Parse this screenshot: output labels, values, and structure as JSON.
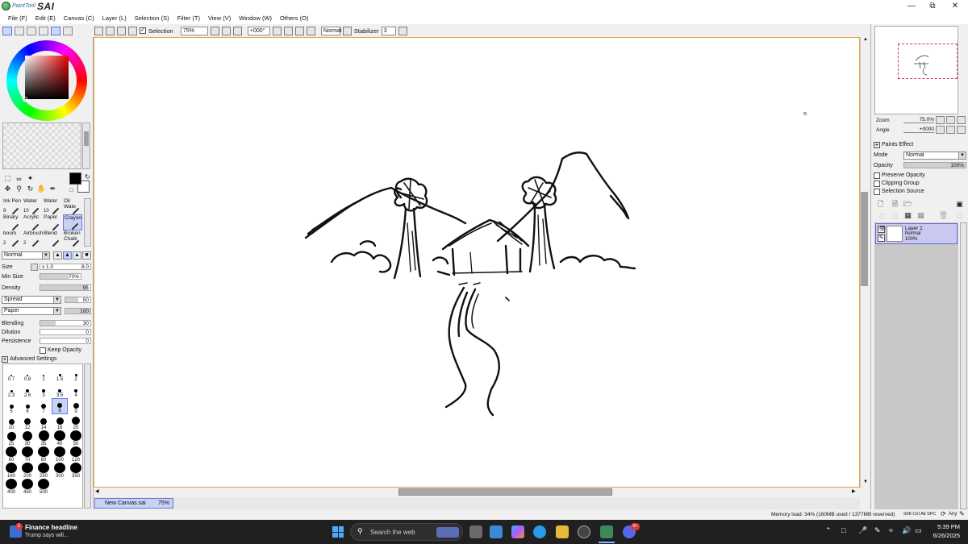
{
  "app": {
    "logo_small": "PaintTool",
    "logo_big": "SAI",
    "window_controls": [
      "minimize-icon",
      "restore-icon",
      "close-icon"
    ]
  },
  "menu": [
    "File (F)",
    "Edit (E)",
    "Canvas (C)",
    "Layer (L)",
    "Selection (S)",
    "Filter (T)",
    "View (V)",
    "Window (W)",
    "Others (O)"
  ],
  "toolbar": {
    "selection_label": "Selection",
    "zoom_value": "75%",
    "angle_value": "+000°",
    "mode_value": "Normal",
    "stabilizer_label": "Stabilizer",
    "stabilizer_value": "3"
  },
  "brushes": [
    {
      "name": "Ink Pen",
      "size": "9"
    },
    {
      "name": "Water",
      "size": "10"
    },
    {
      "name": "Water",
      "size": "10"
    },
    {
      "name": "Oil Wate",
      "size": ""
    },
    {
      "name": "Binary",
      "size": ""
    },
    {
      "name": "Acrylic",
      "size": ""
    },
    {
      "name": "Paper",
      "size": ""
    },
    {
      "name": "Crayon",
      "size": ""
    },
    {
      "name": "boom",
      "size": "2"
    },
    {
      "name": "Airbrush",
      "size": "2"
    },
    {
      "name": "Blend",
      "size": ""
    },
    {
      "name": "Broken Chalk",
      "size": ""
    }
  ],
  "selected_brush": "Crayon",
  "brush_props": {
    "blend_mode": "Normal",
    "size_label": "Size",
    "size_mult": "x 1.0",
    "size_value": "8.0",
    "min_size_label": "Min Size",
    "min_size_value": "70%",
    "min_size_fraction": 0.7,
    "density_label": "Density",
    "density_value": "95",
    "density_fraction": 0.95,
    "spread_label": "Spread",
    "spread_value": "50",
    "paper_label": "Paper",
    "paper_value": "100",
    "blending_label": "Blending",
    "blending_value": "30",
    "blending_fraction": 0.3,
    "dilution_label": "Dilution",
    "dilution_value": "0",
    "persistence_label": "Persistence",
    "persistence_value": "0",
    "keep_opacity_label": "Keep Opacity",
    "advanced_label": "Advanced Settings"
  },
  "brush_sizes": [
    "0.7",
    "0.8",
    "1",
    "1.5",
    "2",
    "2.3",
    "2.6",
    "3",
    "3.5",
    "4",
    "5",
    "6",
    "7",
    "8",
    "9",
    "10",
    "12",
    "14",
    "16",
    "20",
    "25",
    "30",
    "35",
    "40",
    "50",
    "60",
    "70",
    "80",
    "100",
    "120",
    "160",
    "200",
    "250",
    "300",
    "350",
    "400",
    "450",
    "500"
  ],
  "selected_brush_size": "8",
  "navigator": {
    "zoom_label": "Zoom",
    "zoom_value": "75.0%",
    "angle_label": "Angle",
    "angle_value": "+0000"
  },
  "layer_props": {
    "paints_effect_label": "Paints Effect",
    "mode_label": "Mode",
    "mode_value": "Normal",
    "opacity_label": "Opacity",
    "opacity_value": "100%",
    "preserve_opacity_label": "Preserve Opacity",
    "clipping_group_label": "Clipping Group",
    "selection_source_label": "Selection Source"
  },
  "layers": [
    {
      "name": "Layer 1",
      "mode": "Normal",
      "opacity": "100%"
    }
  ],
  "document_tab": {
    "name": "New Canvas.sai",
    "zoom": "75%"
  },
  "status": {
    "memory": "Memory load: 34% (160MB used / 1377MB reserved)",
    "keys": "Shft Ctrl Alt SPC",
    "any": "Any"
  },
  "taskbar": {
    "news_title": "Finance headline",
    "news_sub": "Trump says will...",
    "news_badge": "2",
    "search_placeholder": "Search the web",
    "time": "5:39 PM",
    "date": "6/26/2025",
    "discord_badge": "9+"
  },
  "colors": {
    "accent": "#6a7ad8",
    "canvas_border": "#e8a24a",
    "taskbar": "#202020"
  }
}
